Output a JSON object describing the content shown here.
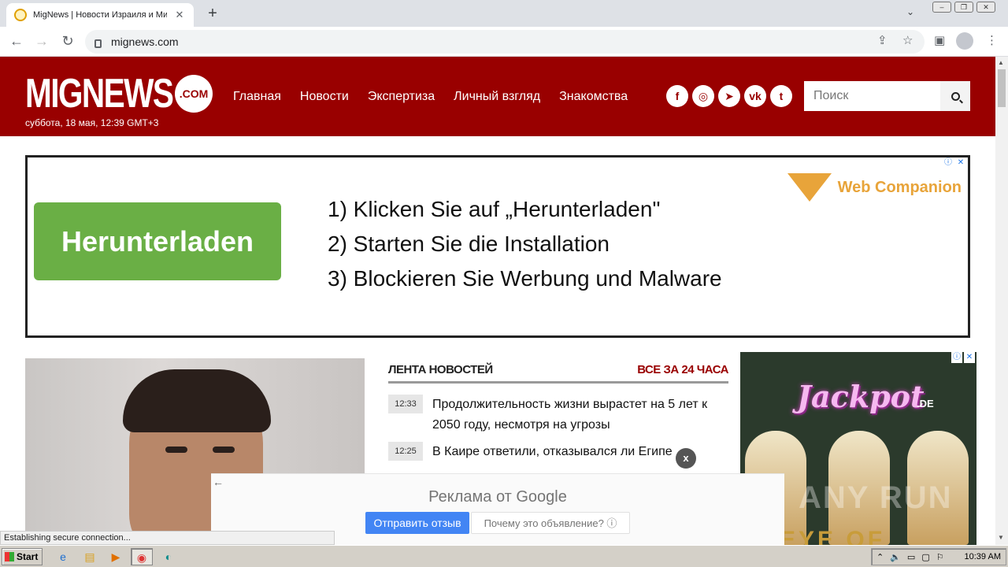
{
  "browser": {
    "tab_title": "MigNews | Новости Израиля и Мира",
    "url": "mignews.com"
  },
  "site": {
    "logo": "MIGNEWS",
    "logo_suffix": ".COM",
    "date": "суббота, 18 мая, 12:39 GMT+3",
    "nav": [
      "Главная",
      "Новости",
      "Экспертиза",
      "Личный взгляд",
      "Знакомства"
    ],
    "socials": [
      "facebook-icon",
      "instagram-icon",
      "telegram-icon",
      "vk-icon",
      "twitter-icon"
    ],
    "search_placeholder": "Поиск"
  },
  "ad_banner": {
    "button": "Herunterladen",
    "steps": [
      "1) Klicken Sie auf „Herunterladen\"",
      "2) Starten Sie die Installation",
      "3) Blockieren Sie Werbung und Malware"
    ],
    "brand": "Web Companion"
  },
  "feed": {
    "title": "ЛЕНТА НОВОСТЕЙ",
    "all_link": "ВСЕ ЗА 24 ЧАСА",
    "items": [
      {
        "time": "12:33",
        "text": "Продолжительность жизни вырастет на 5 лет к 2050 году, несмотря на угрозы"
      },
      {
        "time": "12:25",
        "text": "В Каире ответили, отказывался ли Египе"
      }
    ]
  },
  "side_ad": {
    "title": "Jackpot",
    "suffix": ".DE",
    "bottom_text": "EYE OF"
  },
  "google_ad": {
    "title": "Реклама от Google",
    "send_feedback": "Отправить отзыв",
    "why": "Почему это объявление? ⓘ",
    "close": "x"
  },
  "status_bar": "Establishing secure connection...",
  "watermark": "ANY RUN",
  "taskbar": {
    "start": "Start",
    "clock": "10:39 AM"
  },
  "colors": {
    "brand": "#990000",
    "ad_button": "#6aaf45",
    "google_blue": "#4285f4"
  }
}
